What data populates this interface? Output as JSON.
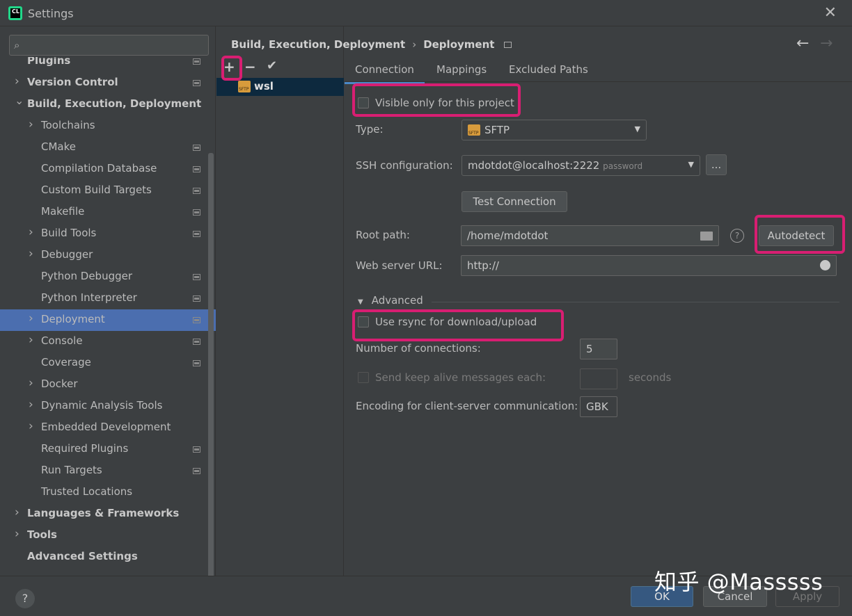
{
  "window": {
    "title": "Settings",
    "close": "✕"
  },
  "search": {
    "placeholder": ""
  },
  "tree": [
    {
      "label": "Plugins",
      "bold": true,
      "chevron": false,
      "icon": true
    },
    {
      "label": "Version Control",
      "bold": true,
      "chevron": true,
      "icon": true
    },
    {
      "label": "Build, Execution, Deployment",
      "bold": true,
      "chevron": true,
      "expanded": true,
      "icon": false
    },
    {
      "label": "Toolchains",
      "bold": false,
      "chevron": true,
      "icon": false
    },
    {
      "label": "CMake",
      "bold": false,
      "chevron": false,
      "icon": true
    },
    {
      "label": "Compilation Database",
      "bold": false,
      "chevron": false,
      "icon": true
    },
    {
      "label": "Custom Build Targets",
      "bold": false,
      "chevron": false,
      "icon": true
    },
    {
      "label": "Makefile",
      "bold": false,
      "chevron": false,
      "icon": true
    },
    {
      "label": "Build Tools",
      "bold": false,
      "chevron": true,
      "icon": true
    },
    {
      "label": "Debugger",
      "bold": false,
      "chevron": true,
      "icon": false
    },
    {
      "label": "Python Debugger",
      "bold": false,
      "chevron": false,
      "icon": true
    },
    {
      "label": "Python Interpreter",
      "bold": false,
      "chevron": false,
      "icon": true
    },
    {
      "label": "Deployment",
      "bold": false,
      "chevron": true,
      "icon": true,
      "selected": true
    },
    {
      "label": "Console",
      "bold": false,
      "chevron": true,
      "icon": true
    },
    {
      "label": "Coverage",
      "bold": false,
      "chevron": false,
      "icon": true
    },
    {
      "label": "Docker",
      "bold": false,
      "chevron": true,
      "icon": false
    },
    {
      "label": "Dynamic Analysis Tools",
      "bold": false,
      "chevron": true,
      "icon": false
    },
    {
      "label": "Embedded Development",
      "bold": false,
      "chevron": true,
      "icon": false
    },
    {
      "label": "Required Plugins",
      "bold": false,
      "chevron": false,
      "icon": true
    },
    {
      "label": "Run Targets",
      "bold": false,
      "chevron": false,
      "icon": true
    },
    {
      "label": "Trusted Locations",
      "bold": false,
      "chevron": false,
      "icon": false
    },
    {
      "label": "Languages & Frameworks",
      "bold": true,
      "chevron": true,
      "icon": false
    },
    {
      "label": "Tools",
      "bold": true,
      "chevron": true,
      "icon": false
    },
    {
      "label": "Advanced Settings",
      "bold": true,
      "chevron": false,
      "icon": false
    }
  ],
  "toolbar": {
    "add": "+",
    "remove": "−",
    "default": "✔"
  },
  "server": {
    "name": "wsl"
  },
  "breadcrumb": {
    "parent": "Build, Execution, Deployment",
    "sep": "›",
    "current": "Deployment"
  },
  "nav": {
    "back": "←",
    "forward": "→"
  },
  "tabs": [
    "Connection",
    "Mappings",
    "Excluded Paths"
  ],
  "form": {
    "visible_only": "Visible only for this project",
    "type_label": "Type:",
    "type_value": "SFTP",
    "ssh_label": "SSH configuration:",
    "ssh_value": "mdotdot@localhost:2222",
    "ssh_hint": "password",
    "ssh_more": "...",
    "test_connection": "Test Connection",
    "root_label": "Root path:",
    "root_value": "/home/mdotdot",
    "autodetect": "Autodetect",
    "web_label": "Web server URL:",
    "web_value": "http://",
    "advanced": "Advanced",
    "rsync": "Use rsync for download/upload",
    "connections_label": "Number of connections:",
    "connections_value": "5",
    "keepalive_label": "Send keep alive messages each:",
    "keepalive_unit": "seconds",
    "encoding_label": "Encoding for client-server communication:",
    "encoding_value": "GBK"
  },
  "footer": {
    "help": "?",
    "ok": "OK",
    "cancel": "Cancel",
    "apply": "Apply"
  },
  "watermark": "知乎 @Masssss",
  "colors": {
    "accent": "#4b6eaf",
    "highlight": "#d81e72",
    "background": "#3c3f41"
  }
}
